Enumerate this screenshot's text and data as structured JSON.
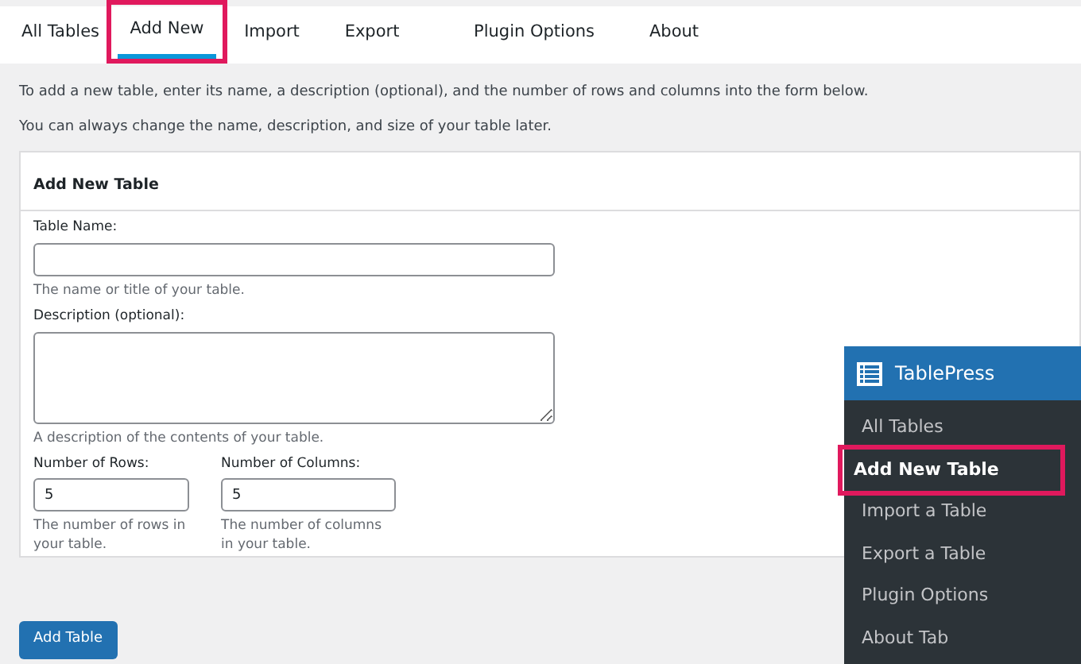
{
  "tabs": [
    {
      "label": "All Tables",
      "selected": false,
      "highlighted": false
    },
    {
      "label": "Add New",
      "selected": true,
      "highlighted": true
    },
    {
      "label": "Import",
      "selected": false,
      "highlighted": false
    },
    {
      "label": "Export",
      "selected": false,
      "highlighted": false
    },
    {
      "label": "Plugin Options",
      "selected": false,
      "highlighted": false
    },
    {
      "label": "About",
      "selected": false,
      "highlighted": false
    }
  ],
  "intro": [
    "To add a new table, enter its name, a description (optional), and the number of rows and columns into the form below.",
    "You can always change the name, description, and size of your table later."
  ],
  "form": {
    "title": "Add New Table",
    "name_field": {
      "label": "Table Name:",
      "help": "The name or title of your table."
    },
    "description_field": {
      "label": "Description (optional):",
      "help": "A description of the contents of your table."
    },
    "rows_field": {
      "label": "Number of Rows:",
      "value": "5",
      "help": "The number of rows in your table."
    },
    "columns_field": {
      "label": "Number of Columns:",
      "value": "5",
      "help": "The number of columns in your table."
    }
  },
  "submit_button": "Add Table",
  "menu": {
    "title": "TablePress",
    "items": [
      {
        "label": "All Tables",
        "selected": false,
        "highlighted": false
      },
      {
        "label": "Add New Table",
        "selected": true,
        "highlighted": true
      },
      {
        "label": "Import a Table",
        "selected": false,
        "highlighted": false
      },
      {
        "label": "Export a Table",
        "selected": false,
        "highlighted": false
      },
      {
        "label": "Plugin Options",
        "selected": false,
        "highlighted": false
      },
      {
        "label": "About Tab",
        "selected": false,
        "highlighted": false
      }
    ]
  }
}
